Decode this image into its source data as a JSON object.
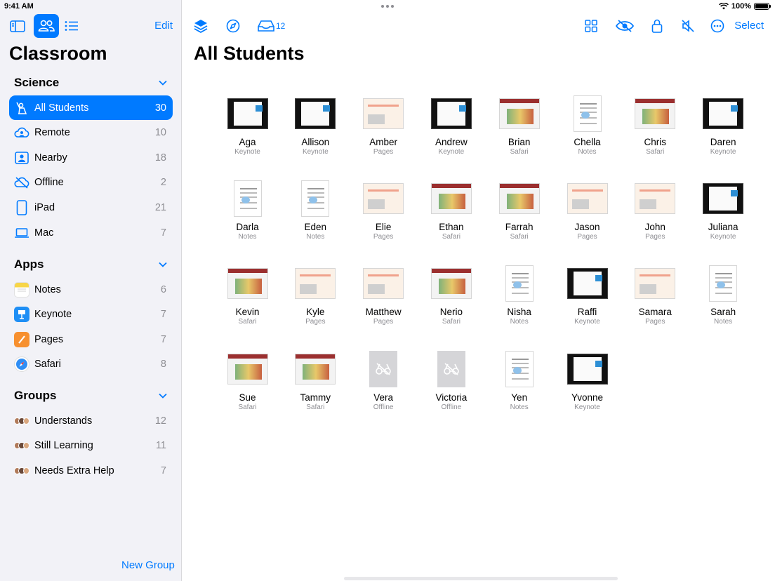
{
  "status": {
    "time": "9:41 AM",
    "battery": "100%"
  },
  "sidebar": {
    "edit_label": "Edit",
    "title": "Classroom",
    "sections": [
      {
        "heading": "Science",
        "items": [
          {
            "label": "All Students",
            "count": "30",
            "icon": "person-raising-hand-icon",
            "selected": true
          },
          {
            "label": "Remote",
            "count": "10",
            "icon": "remote-cloud-icon"
          },
          {
            "label": "Nearby",
            "count": "18",
            "icon": "nearby-person-icon"
          },
          {
            "label": "Offline",
            "count": "2",
            "icon": "offline-cloud-icon"
          },
          {
            "label": "iPad",
            "count": "21",
            "icon": "ipad-icon"
          },
          {
            "label": "Mac",
            "count": "7",
            "icon": "laptop-icon"
          }
        ]
      },
      {
        "heading": "Apps",
        "items": [
          {
            "label": "Notes",
            "count": "6",
            "icon": "notes-app-icon"
          },
          {
            "label": "Keynote",
            "count": "7",
            "icon": "keynote-app-icon"
          },
          {
            "label": "Pages",
            "count": "7",
            "icon": "pages-app-icon"
          },
          {
            "label": "Safari",
            "count": "8",
            "icon": "safari-app-icon"
          }
        ]
      },
      {
        "heading": "Groups",
        "items": [
          {
            "label": "Understands",
            "count": "12",
            "icon": "group-avatars-icon"
          },
          {
            "label": "Still Learning",
            "count": "11",
            "icon": "group-avatars-icon"
          },
          {
            "label": "Needs Extra Help",
            "count": "7",
            "icon": "group-avatars-icon"
          }
        ]
      }
    ],
    "new_group_label": "New Group"
  },
  "toolbar": {
    "inbox_badge": "12",
    "select_label": "Select"
  },
  "main": {
    "title": "All Students"
  },
  "students": [
    {
      "name": "Aga",
      "app": "Keynote"
    },
    {
      "name": "Allison",
      "app": "Keynote"
    },
    {
      "name": "Amber",
      "app": "Pages"
    },
    {
      "name": "Andrew",
      "app": "Keynote"
    },
    {
      "name": "Brian",
      "app": "Safari"
    },
    {
      "name": "Chella",
      "app": "Notes"
    },
    {
      "name": "Chris",
      "app": "Safari"
    },
    {
      "name": "Daren",
      "app": "Keynote"
    },
    {
      "name": "Darla",
      "app": "Notes"
    },
    {
      "name": "Eden",
      "app": "Notes"
    },
    {
      "name": "Elie",
      "app": "Pages"
    },
    {
      "name": "Ethan",
      "app": "Safari"
    },
    {
      "name": "Farrah",
      "app": "Safari"
    },
    {
      "name": "Jason",
      "app": "Pages"
    },
    {
      "name": "John",
      "app": "Pages"
    },
    {
      "name": "Juliana",
      "app": "Keynote"
    },
    {
      "name": "Kevin",
      "app": "Safari"
    },
    {
      "name": "Kyle",
      "app": "Pages"
    },
    {
      "name": "Matthew",
      "app": "Pages"
    },
    {
      "name": "Nerio",
      "app": "Safari"
    },
    {
      "name": "Nisha",
      "app": "Notes"
    },
    {
      "name": "Raffi",
      "app": "Keynote"
    },
    {
      "name": "Samara",
      "app": "Pages"
    },
    {
      "name": "Sarah",
      "app": "Notes"
    },
    {
      "name": "Sue",
      "app": "Safari"
    },
    {
      "name": "Tammy",
      "app": "Safari"
    },
    {
      "name": "Vera",
      "app": "Offline"
    },
    {
      "name": "Victoria",
      "app": "Offline"
    },
    {
      "name": "Yen",
      "app": "Notes"
    },
    {
      "name": "Yvonne",
      "app": "Keynote"
    }
  ],
  "colors": {
    "accent": "#007aff",
    "secondary_text": "#8e8e93",
    "sidebar_bg": "#f2f2f7"
  }
}
